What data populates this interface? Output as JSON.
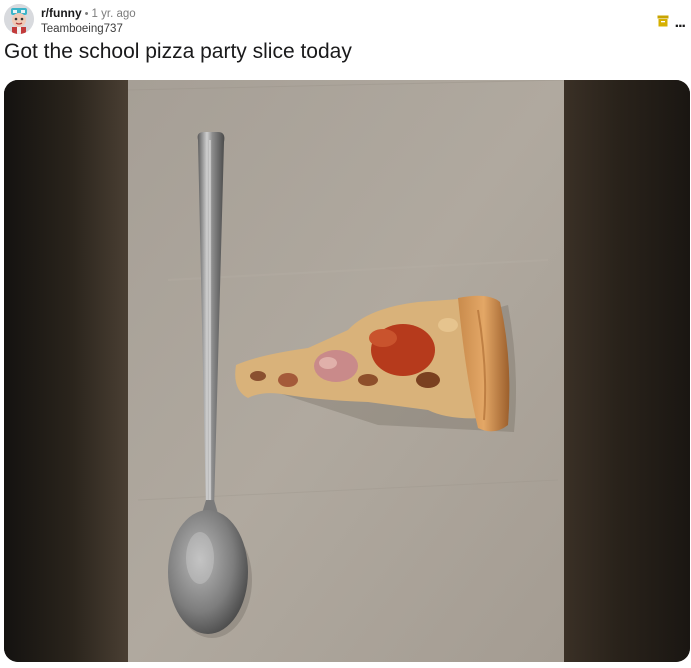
{
  "post": {
    "subreddit": "r/funny",
    "separator": "•",
    "age": "1 yr. ago",
    "author": "Teamboeing737",
    "title": "Got the school pizza party slice today"
  },
  "actions": {
    "archive_icon": "archive-icon",
    "more_label": "..."
  },
  "media": {
    "description_icon": "photo",
    "colors": {
      "cardboard": "#aaa49b",
      "spoon": "#9a9a9a",
      "crust": "#c88a4a",
      "sauce": "#b63a1c"
    }
  }
}
